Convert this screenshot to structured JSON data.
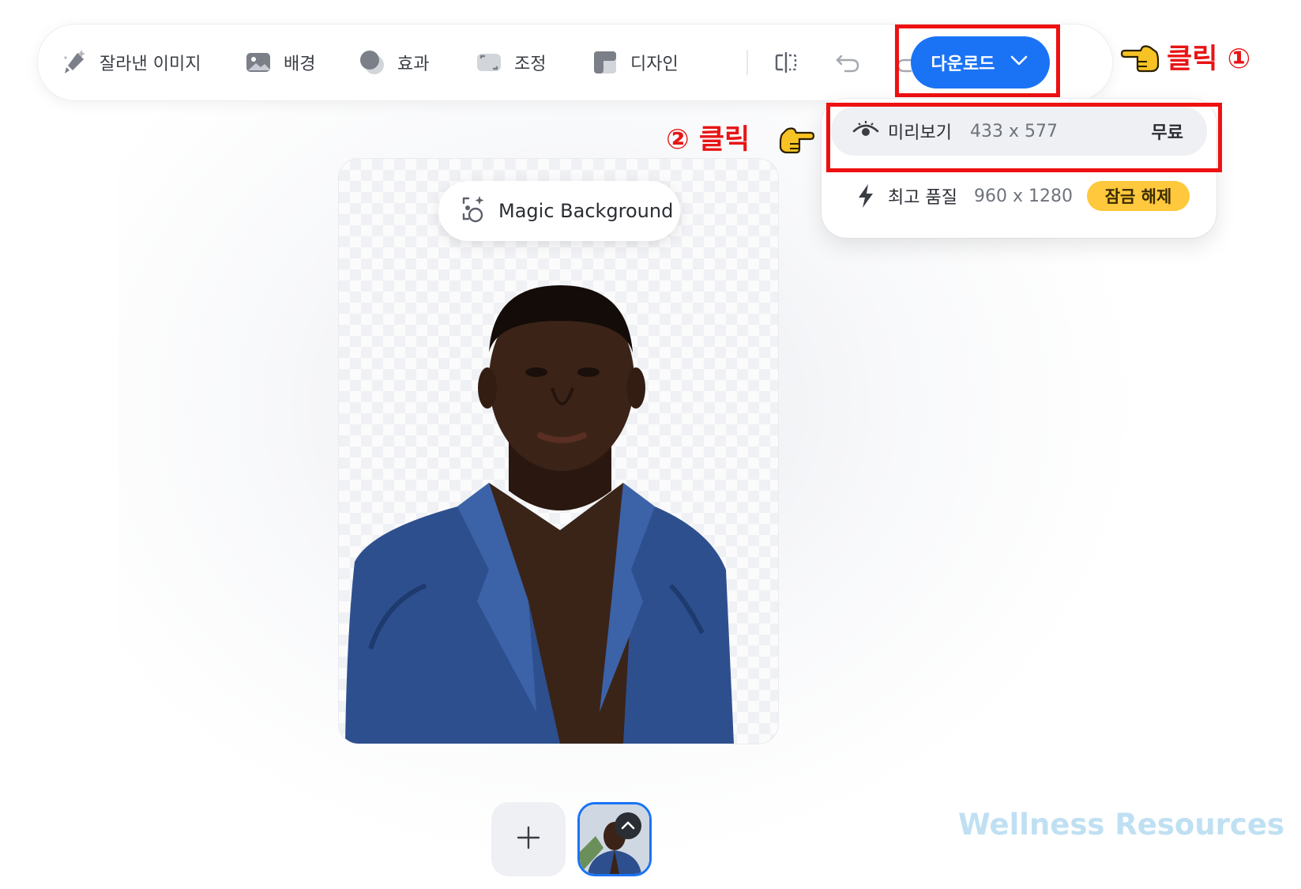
{
  "toolbar": {
    "items": [
      {
        "label": "잘라낸 이미지",
        "icon": "brush-sparkle-icon"
      },
      {
        "label": "배경",
        "icon": "image-icon"
      },
      {
        "label": "효과",
        "icon": "circles-icon"
      },
      {
        "label": "조정",
        "icon": "adjust-icon"
      },
      {
        "label": "디자인",
        "icon": "layout-icon"
      }
    ],
    "compare_icon": "compare-icon",
    "undo_icon": "undo-icon",
    "redo_icon": "redo-icon",
    "download_label": "다운로드",
    "colors": {
      "accent": "#1a73f5",
      "highlight": "#ee1111",
      "unlock": "#ffc83d"
    }
  },
  "dropdown": {
    "preview": {
      "label": "미리보기",
      "size": "433 x 577",
      "badge": "무료",
      "icon": "eye-icon"
    },
    "hq": {
      "label": "최고 품질",
      "size": "960 x 1280",
      "badge": "잠금 해제",
      "icon": "lightning-icon"
    }
  },
  "annotations": {
    "step1": "클릭 ①",
    "step2": "② 클릭"
  },
  "canvas": {
    "magic_label": "Magic Background"
  },
  "bottom": {
    "watermark": "Wellness Resources"
  }
}
